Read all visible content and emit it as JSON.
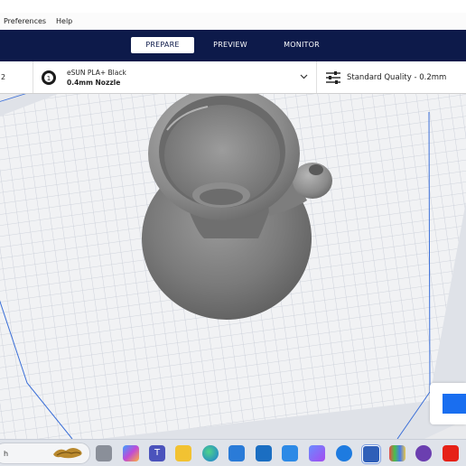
{
  "menu": {
    "items": [
      "Preferences",
      "Help"
    ]
  },
  "stages": {
    "tabs": [
      "PREPARE",
      "PREVIEW",
      "MONITOR"
    ],
    "active": "PREPARE"
  },
  "settings": {
    "printer_fragment": "2",
    "extruder_badge": "1",
    "material": "eSUN PLA+ Black",
    "nozzle": "0.4mm Nozzle",
    "profile": "Standard Quality - 0.2mm"
  },
  "taskbar": {
    "search_fragment": "h",
    "icons": [
      "file-explorer-icon",
      "copilot-icon",
      "teams-icon",
      "folder-icon",
      "edge-icon",
      "store-icon",
      "mail-icon",
      "azure-data-studio-icon",
      "app-icon",
      "teamviewer-icon",
      "cura-icon",
      "color-app-icon",
      "purple-app-icon",
      "youtube-icon"
    ]
  },
  "colors": {
    "navy": "#0d1a4a",
    "accent_blue": "#196ef0",
    "model_gray": "#7a7a7a",
    "grid_line": "#c9ced9"
  }
}
